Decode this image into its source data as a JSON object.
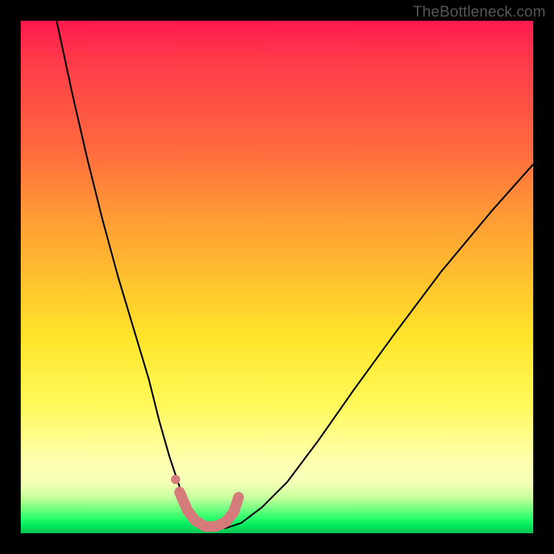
{
  "watermark": "TheBottleneck.com",
  "chart_data": {
    "type": "line",
    "title": "",
    "xlabel": "",
    "ylabel": "",
    "xlim": [
      0,
      100
    ],
    "ylim": [
      0,
      100
    ],
    "grid": false,
    "legend": false,
    "background_gradient_stops": [
      {
        "pos": 0,
        "color": "#ff1a4d"
      },
      {
        "pos": 25,
        "color": "#ff6a3f"
      },
      {
        "pos": 50,
        "color": "#ffc02e"
      },
      {
        "pos": 75,
        "color": "#fff95a"
      },
      {
        "pos": 95,
        "color": "#7dff84"
      },
      {
        "pos": 100,
        "color": "#00c653"
      }
    ],
    "series": [
      {
        "name": "bottleneck-curve",
        "stroke": "#000000",
        "stroke_width": 2,
        "x": [
          7,
          10,
          13,
          16,
          19,
          22,
          25,
          27,
          29,
          31,
          33,
          35,
          37,
          40,
          43,
          47,
          52,
          58,
          65,
          73,
          82,
          92,
          100
        ],
        "values": [
          100,
          86,
          73,
          61,
          50,
          40,
          30,
          22,
          15,
          9,
          5,
          2,
          1,
          1,
          2,
          5,
          10,
          18,
          28,
          39,
          51,
          63,
          72
        ]
      },
      {
        "name": "optimal-zone-marker",
        "stroke": "#d57b7b",
        "stroke_width": 14,
        "linecap": "round",
        "x": [
          31,
          32.5,
          34,
          36,
          38,
          40,
          41.5,
          42.5
        ],
        "values": [
          8,
          4.5,
          2.5,
          1.3,
          1.3,
          2.2,
          4,
          7
        ]
      }
    ],
    "extra_points": [
      {
        "name": "marker-dot-left",
        "x": 30.2,
        "y": 10.5,
        "r": 6,
        "color": "#d57b7b"
      }
    ]
  }
}
